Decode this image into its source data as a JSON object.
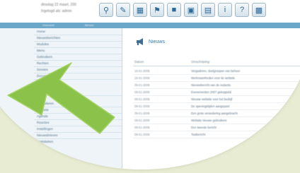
{
  "header": {
    "info_line1": "dinsdag 22 maart, 200",
    "info_line2": "Ingelogd als: admin"
  },
  "toolbar": {
    "icons": [
      "search-icon",
      "pencil-icon",
      "calendar-icon",
      "tag-icon",
      "lock-icon",
      "monitor-icon",
      "document-icon",
      "info-icon",
      "help-icon",
      "window-icon"
    ]
  },
  "tabs": [
    "Overzicht",
    "Beheer"
  ],
  "sidebar": {
    "items": [
      "Home",
      "Nieuwsberichten",
      "Modules",
      "Menu",
      "Gebruikers",
      "Rechten",
      "Sessies",
      "Documenten",
      "Bestanden & downloads",
      "Formulieren",
      "Enquete",
      "Agenda",
      "Reacties",
      "Instellingen",
      "Nieuwsbrieven",
      "Statistieken"
    ]
  },
  "news": {
    "title": "Nieuws",
    "columns": [
      "Datum",
      "Omschrijving"
    ],
    "rows": [
      {
        "date": "16-01-2008",
        "desc": "Vergaderen, doelgroepen van beheer"
      },
      {
        "date": "16-01-2008",
        "desc": "Werkzaamheden voor de website"
      },
      {
        "date": "09-01-2008",
        "desc": "Nieuwsbericht van de redactie"
      },
      {
        "date": "09-01-2008",
        "desc": "Evenementen 2007 gekoppeld"
      },
      {
        "date": "09-01-2008",
        "desc": "Nieuwe website voor het bedrijf"
      },
      {
        "date": "09-01-2008",
        "desc": "De openingstijden aangepast"
      },
      {
        "date": "09-01-2008",
        "desc": "Een grote verandering aangebracht"
      },
      {
        "date": "09-01-2008",
        "desc": "Website nieuwe gebruikers"
      },
      {
        "date": "09-01-2008",
        "desc": "Een tweede bericht"
      },
      {
        "date": "09-01-2008",
        "desc": "Testbericht"
      }
    ]
  },
  "colors": {
    "background": "#e8ecd2",
    "arrow": "#8bc34a",
    "accent": "#6aa7c9",
    "link": "#2f78b7"
  }
}
